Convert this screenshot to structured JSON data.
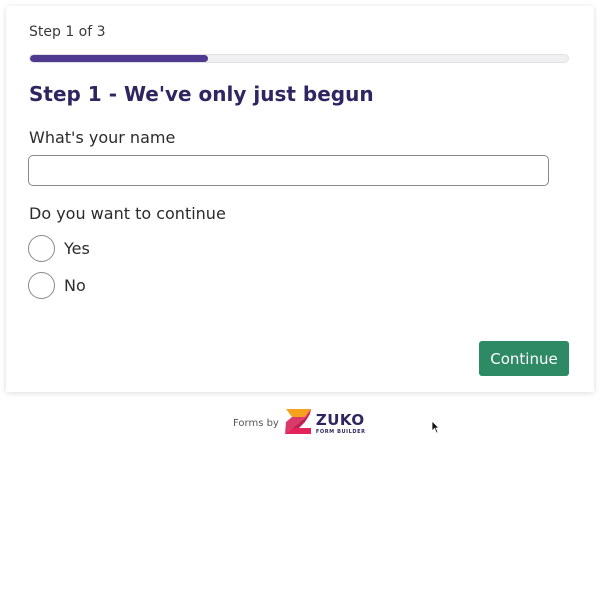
{
  "form": {
    "step_label": "Step 1 of 3",
    "progress_fraction": 0.33,
    "title": "Step 1 - We've only just begun",
    "name_question": "What's your name",
    "name_value": "",
    "continue_question": "Do you want to continue",
    "options": [
      "Yes",
      "No"
    ],
    "continue_label": "Continue"
  },
  "footer": {
    "forms_by": "Forms by",
    "logo_word": "ZUKO",
    "logo_sub": "FORM BUILDER"
  },
  "colors": {
    "accent": "#4e3a91",
    "title": "#2e2660",
    "button": "#2e8a65",
    "logo_pink": "#e3245a",
    "logo_orange": "#f6a21e"
  }
}
